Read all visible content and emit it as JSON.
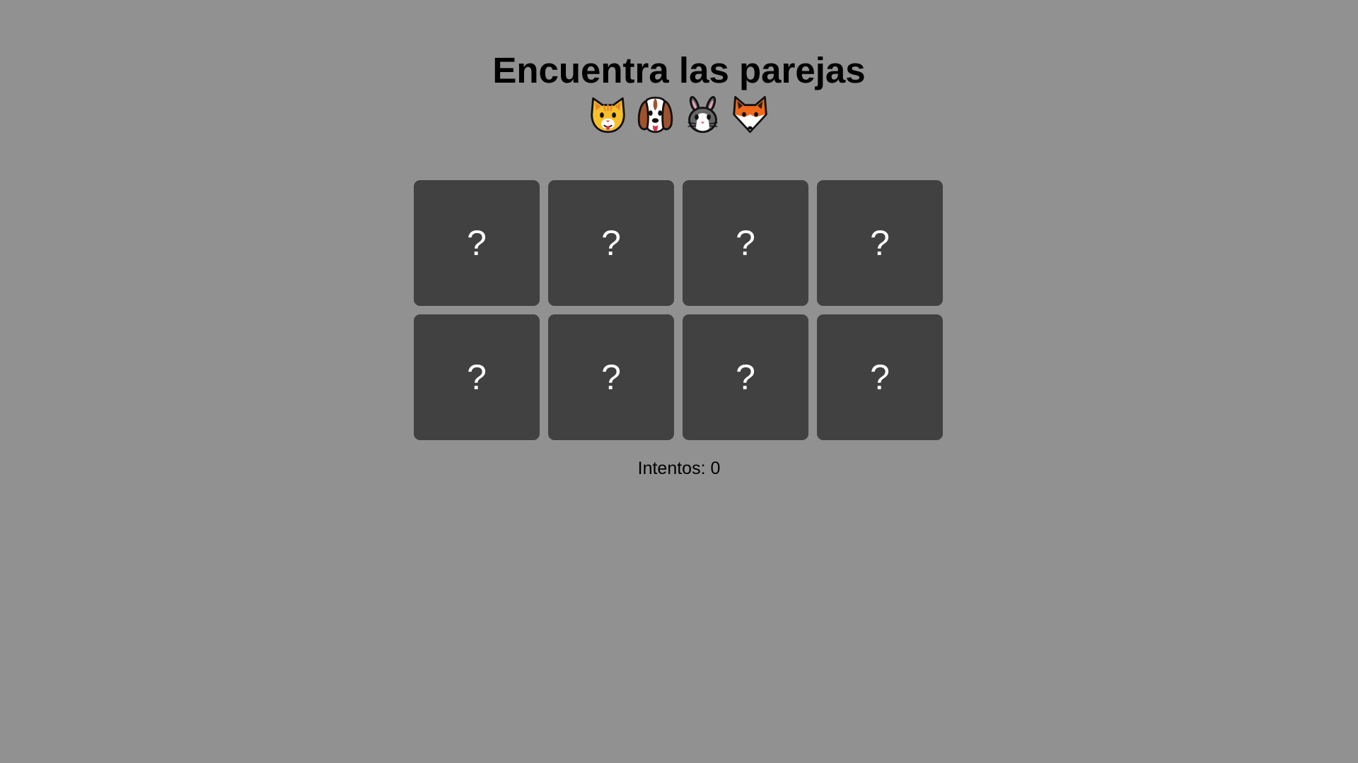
{
  "header": {
    "title": "Encuentra las parejas",
    "animals": [
      {
        "icon": "cat-face-icon"
      },
      {
        "icon": "dog-face-icon"
      },
      {
        "icon": "rabbit-face-icon"
      },
      {
        "icon": "fox-face-icon"
      }
    ]
  },
  "board": {
    "cards": [
      {
        "label": "?",
        "face_down": true
      },
      {
        "label": "?",
        "face_down": true
      },
      {
        "label": "?",
        "face_down": true
      },
      {
        "label": "?",
        "face_down": true
      },
      {
        "label": "?",
        "face_down": true
      },
      {
        "label": "?",
        "face_down": true
      },
      {
        "label": "?",
        "face_down": true
      },
      {
        "label": "?",
        "face_down": true
      }
    ]
  },
  "status": {
    "attempts_text": "Intentos: 0"
  },
  "colors": {
    "background": "#919191",
    "card": "#414141",
    "card_mark": "#ffffff"
  }
}
